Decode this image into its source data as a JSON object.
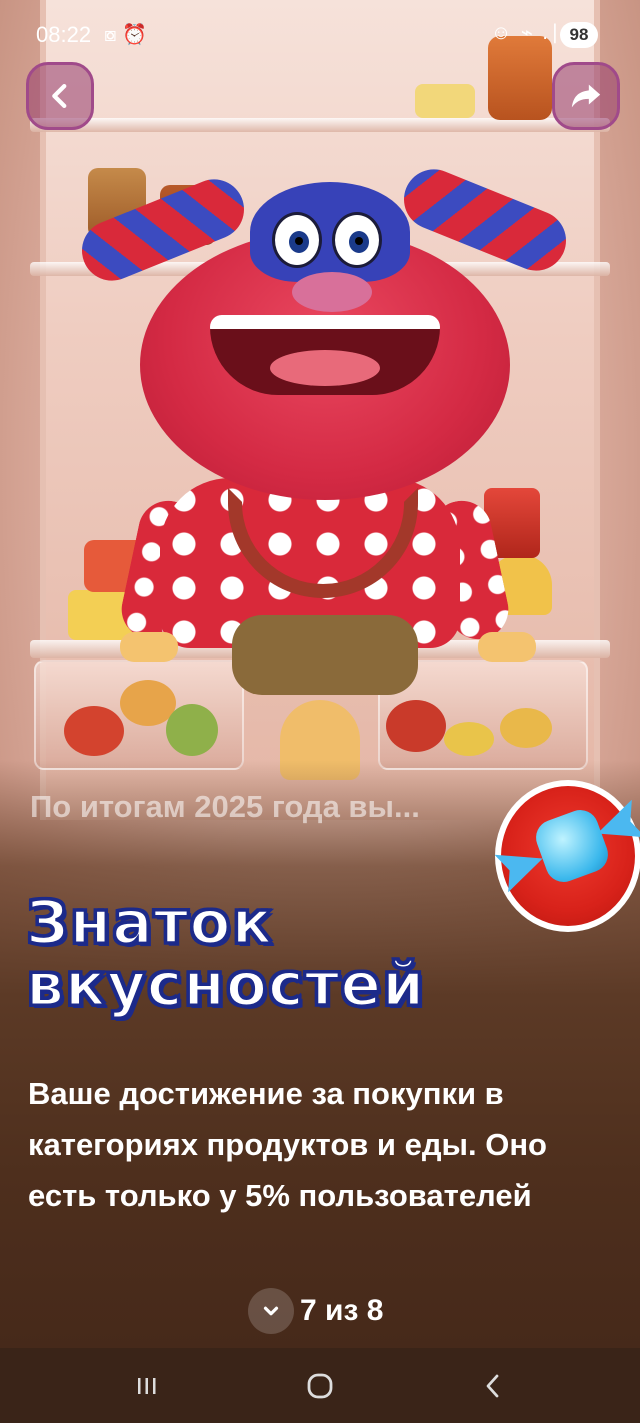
{
  "status": {
    "time": "08:22",
    "left_icons": "⧇ ⏰",
    "right_icons": "☺ ⌁ .∣",
    "battery": "98"
  },
  "nav": {
    "back_icon": "chevron-left-icon",
    "share_icon": "share-arrow-icon"
  },
  "content": {
    "subtitle": "По итогам 2025 года вы...",
    "title": "Знаток вкусностей",
    "description": "Ваше достижение за покупки в категориях продуктов и еды. Оно есть только у 5% пользователей",
    "badge_icon": "candy-icon"
  },
  "pager": {
    "icon": "chevron-down-icon",
    "text": "7 из 8"
  },
  "system_nav": {
    "recent": "recent-apps-icon",
    "home": "home-icon",
    "back": "back-icon"
  },
  "colors": {
    "title_fill": "#ffffff",
    "title_outline": "#1c2a8a",
    "button_accent": "#a04a8a",
    "badge": "#d8221a"
  }
}
